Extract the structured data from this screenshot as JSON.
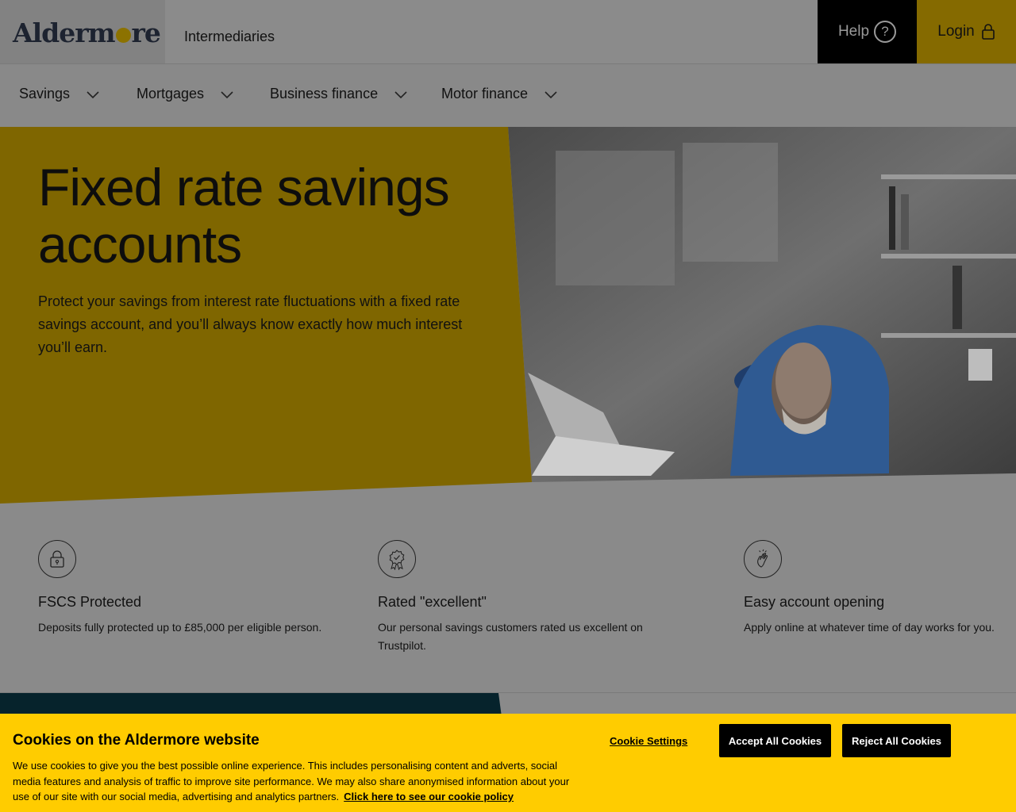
{
  "header": {
    "logo_text_1": "Alderm",
    "logo_text_2": "re",
    "section": "Intermediaries",
    "help_label": "Help",
    "help_icon": "?",
    "login_label": "Login"
  },
  "nav": {
    "items": [
      {
        "label": "Savings"
      },
      {
        "label": "Mortgages"
      },
      {
        "label": "Business finance"
      },
      {
        "label": "Motor finance"
      }
    ]
  },
  "hero": {
    "title": "Fixed rate savings accounts",
    "description": "Protect your savings from interest rate fluctuations with a fixed rate savings account, and you’ll always know exactly how much interest you’ll earn."
  },
  "features": [
    {
      "title": "FSCS Protected",
      "text": "Deposits fully protected up to £85,000 per eligible person.",
      "icon": "padlock-icon"
    },
    {
      "title": "Rated \"excellent\"",
      "text": "Our personal savings customers rated us excellent on Trustpilot.",
      "icon": "award-rosette-icon"
    },
    {
      "title": "Easy account opening",
      "text": "Apply online at whatever time of day works for you.",
      "icon": "hand-tap-icon"
    }
  ],
  "cookie": {
    "title": "Cookies on the Aldermore website",
    "text": "We use cookies to give you the best possible online experience. This includes personalising content and adverts, social media features and analysis of traffic to improve site performance. We may also share anonymised information about your use of our site with our social media, advertising and analytics partners.",
    "policy_link": "Click here to see our cookie policy",
    "settings_label": "Cookie Settings",
    "accept_label": "Accept All Cookies",
    "reject_label": "Reject All Cookies"
  },
  "colors": {
    "brand_yellow": "#ffcc00",
    "hero_yellow_dimmed": "#7f6600",
    "overlay_gray": "#8a8a8a",
    "teal": "#06232c"
  }
}
